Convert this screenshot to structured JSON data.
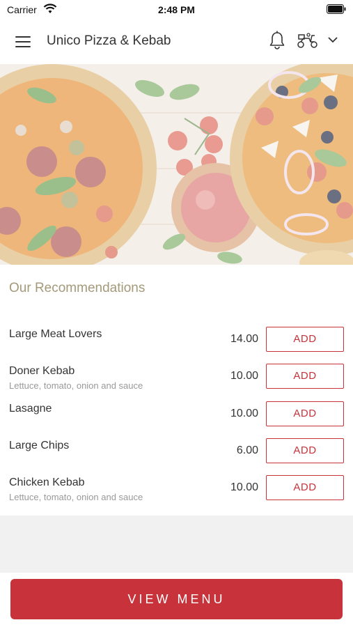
{
  "status_bar": {
    "carrier": "Carrier",
    "time": "2:48 PM"
  },
  "header": {
    "title": "Unico Pizza & Kebab",
    "icons": [
      "menu-icon",
      "bell-icon",
      "scooter-icon",
      "chevron-down-icon"
    ]
  },
  "recommendations": {
    "title": "Our Recommendations",
    "add_label": "ADD",
    "items": [
      {
        "name": "Large Meat Lovers",
        "description": "",
        "price": "14.00"
      },
      {
        "name": "Doner Kebab",
        "description": "Lettuce, tomato, onion and sauce",
        "price": "10.00"
      },
      {
        "name": "Lasagne",
        "description": "",
        "price": "10.00"
      },
      {
        "name": "Large Chips",
        "description": "",
        "price": "6.00"
      },
      {
        "name": "Chicken Kebab",
        "description": "Lettuce, tomato, onion and sauce",
        "price": "10.00"
      }
    ]
  },
  "footer": {
    "view_menu_label": "VIEW MENU"
  },
  "colors": {
    "accent": "#c8323a",
    "section_title": "#a49a7a",
    "band": "#f1f1f1"
  }
}
